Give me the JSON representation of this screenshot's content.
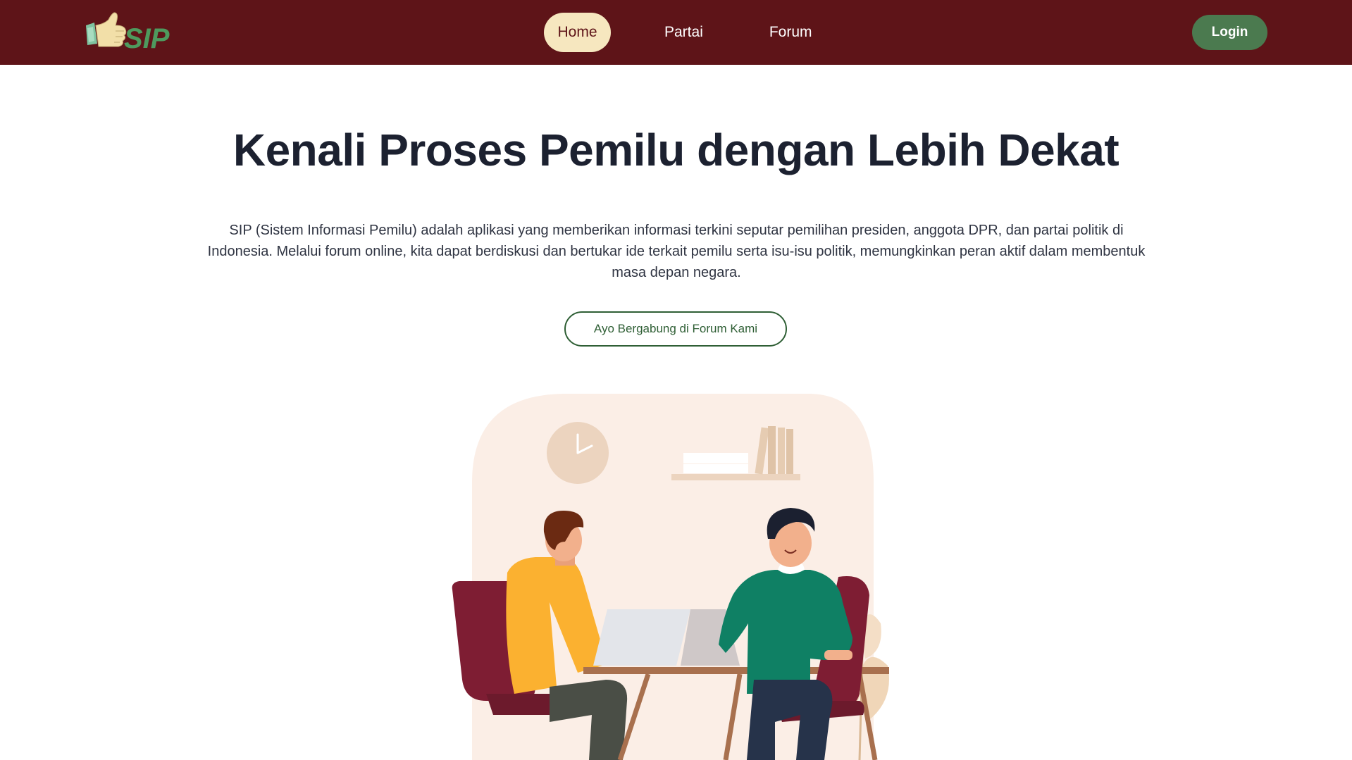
{
  "brand": {
    "logo_text": "SIP"
  },
  "nav": {
    "items": [
      {
        "label": "Home",
        "active": true
      },
      {
        "label": "Partai",
        "active": false
      },
      {
        "label": "Forum",
        "active": false
      }
    ],
    "login_label": "Login"
  },
  "hero": {
    "title": "Kenali Proses Pemilu dengan Lebih Dekat",
    "description": "SIP (Sistem Informasi Pemilu) adalah aplikasi yang memberikan informasi terkini seputar pemilihan presiden, anggota DPR, dan partai politik di Indonesia. Melalui forum online, kita dapat berdiskusi dan bertukar ide terkait pemilu serta isu-isu politik, memungkinkan peran aktif dalam membentuk masa depan negara.",
    "cta_label": "Ayo Bergabung di Forum Kami"
  },
  "colors": {
    "navbar": "#5e1418",
    "active_pill": "#f6e7bf",
    "login": "#4b7a4f",
    "cta_border": "#2f5f35"
  },
  "icons": {
    "logo": "thumbs-up-logo",
    "illustration": "two-people-discussion-laptop"
  }
}
